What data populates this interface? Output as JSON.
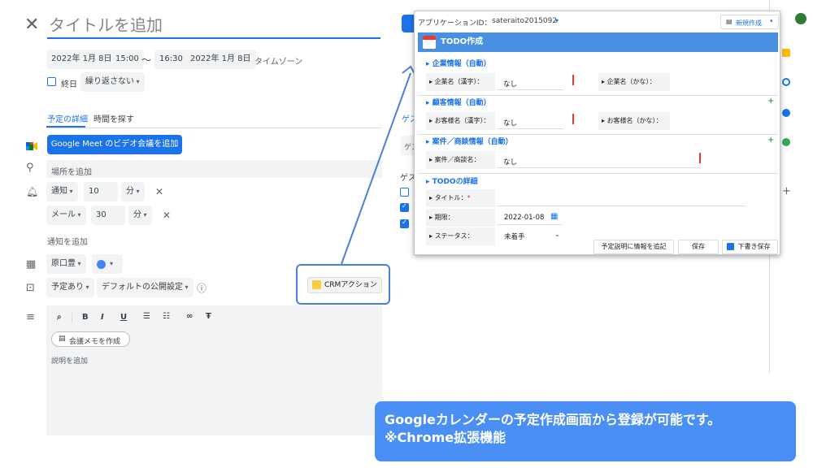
{
  "event": {
    "title_placeholder": "タイトルを追加",
    "start_date": "2022年 1月 8日",
    "start_time": "15:00",
    "tilde": "〜",
    "end_time": "16:30",
    "end_date": "2022年 1月 8日",
    "timezone": "タイムゾーン",
    "allday_label": "終日",
    "repeat": "繰り返さない",
    "tabs": [
      "予定の詳細",
      "時間を探す"
    ],
    "meet_button": "Google Meet のビデオ会議を追加",
    "location_placeholder": "場所を追加",
    "notifications": [
      {
        "type": "通知",
        "value": "10",
        "unit": "分"
      },
      {
        "type": "メール",
        "value": "30",
        "unit": "分"
      }
    ],
    "add_notification": "通知を追加",
    "calendar_owner": "原口豊",
    "availability": "予定あり",
    "visibility": "デフォルトの公開設定",
    "toolbar": [
      "B",
      "I",
      "U"
    ],
    "meeting_notes_button": "会議メモを作成",
    "description_placeholder": "説明を追加",
    "crm_button": "CRMアクション"
  },
  "guests_fragments": {
    "tab": "ゲス",
    "input": "ゲス",
    "label": "ゲス"
  },
  "popup": {
    "app_id_label": "アプリケーションID：",
    "app_id": "sateraito2015092",
    "new_button": "新規作成",
    "title": "TODO作成",
    "sections": [
      {
        "title": "企業情報（自動）",
        "fields": [
          {
            "label": "企業名（漢字）：",
            "value": "なし"
          },
          {
            "label": "企業名（かな）：",
            "value": ""
          }
        ]
      },
      {
        "title": "顧客情報（自動）",
        "fields": [
          {
            "label": "お客様名（漢字）：",
            "value": "なし"
          },
          {
            "label": "お客様名（かな）：",
            "value": ""
          }
        ]
      },
      {
        "title": "案件／商談情報（自動）",
        "fields": [
          {
            "label": "案件／商談名：",
            "value": "なし"
          }
        ]
      },
      {
        "title": "TODOの詳細",
        "fields": [
          {
            "label": "タイトル：",
            "value": ""
          },
          {
            "label": "期限：",
            "value": "2022-01-08"
          },
          {
            "label": "ステータス：",
            "value": "未着手"
          }
        ]
      }
    ],
    "required_mark": "*",
    "buttons": {
      "add_info": "予定説明に情報を追記",
      "save": "保存",
      "draft_save": "下書き保存"
    }
  },
  "banner": {
    "line1": "Googleカレンダーの予定作成画面から登録が可能です。",
    "line2": "※Chrome拡張機能"
  },
  "colors": {
    "accent": "#1a73e8",
    "banner": "#4a8ff5",
    "popup_bar": "#4a90e2"
  }
}
